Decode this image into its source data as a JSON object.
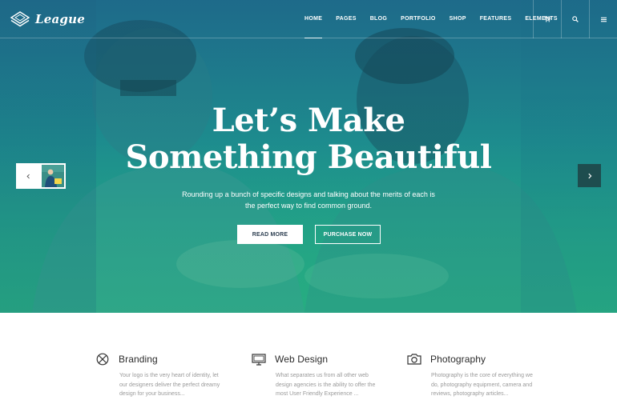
{
  "brand": {
    "name": "League"
  },
  "nav": {
    "items": [
      {
        "label": "HOME",
        "active": true
      },
      {
        "label": "PAGES"
      },
      {
        "label": "BLOG"
      },
      {
        "label": "PORTFOLIO"
      },
      {
        "label": "SHOP"
      },
      {
        "label": "FEATURES"
      },
      {
        "label": "ELEMENTS"
      }
    ],
    "icons": [
      "cart-icon",
      "search-icon",
      "menu-icon"
    ]
  },
  "hero": {
    "headline_line1": "Let’s Make",
    "headline_line2": "Something Beautiful",
    "subtext_line1": "Rounding up a bunch of specific designs and talking about the merits of each is",
    "subtext_line2": "the perfect way to find common ground.",
    "primary_button": "READ MORE",
    "secondary_button": "PURCHASE NOW",
    "prev_icon": "chevron-left-icon",
    "next_icon": "chevron-right-icon",
    "overlay_colors": [
      "#1f6d8a",
      "#27ad80"
    ]
  },
  "features": [
    {
      "title": "Branding",
      "icon": "pencil-cross-icon",
      "desc_line1": "Your logo is the very heart of  identity, let",
      "desc_line2": "our designers deliver the perfect dreamy",
      "desc_line3": "design for your business..."
    },
    {
      "title": "Web Design",
      "icon": "monitor-icon",
      "desc_line1": "What separates us from all other web",
      "desc_line2": "design agencies is the ability to offer the",
      "desc_line3": "most User Friendly Experience ..."
    },
    {
      "title": "Photography",
      "icon": "camera-icon",
      "desc_line1": "Photography is the core of everything we",
      "desc_line2": "do, photography equipment, camera and",
      "desc_line3": "reviews, photography articles..."
    }
  ]
}
